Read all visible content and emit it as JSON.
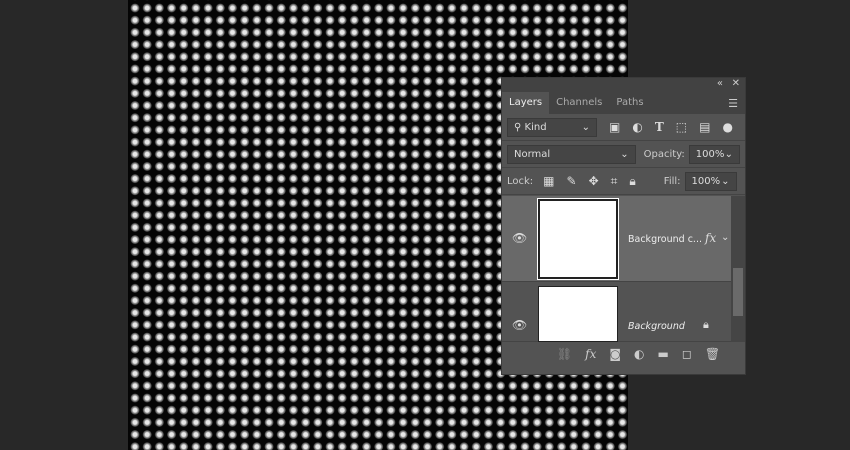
{
  "panel": {
    "tabs": [
      "Layers",
      "Channels",
      "Paths"
    ],
    "filter": "Kind",
    "blend_mode": "Normal",
    "opacity_label": "Opacity:",
    "opacity": "100%",
    "lock_label": "Lock:",
    "fill_label": "Fill:",
    "fill": "100%",
    "layers": [
      {
        "name": "Background c...",
        "fx": "fx"
      },
      {
        "name": "Background"
      }
    ],
    "fx_label": "fx"
  }
}
